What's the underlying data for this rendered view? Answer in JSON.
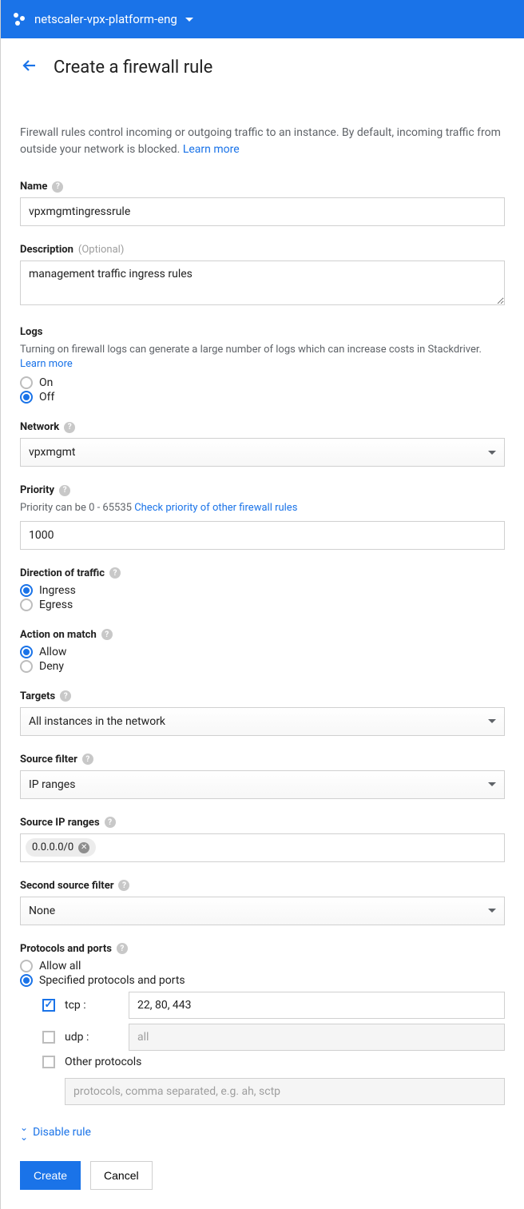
{
  "topbar": {
    "project": "netscaler-vpx-platform-eng"
  },
  "header": {
    "title": "Create a firewall rule"
  },
  "intro": {
    "text": "Firewall rules control incoming or outgoing traffic to an instance. By default, incoming traffic from outside your network is blocked. ",
    "learn_more": "Learn more"
  },
  "name": {
    "label": "Name",
    "value": "vpxmgmtingressrule"
  },
  "description": {
    "label": "Description",
    "optional": "(Optional)",
    "value": "management traffic ingress rules"
  },
  "logs": {
    "label": "Logs",
    "help": "Turning on firewall logs can generate a large number of logs which can increase costs in Stackdriver. ",
    "learn_more": "Learn more",
    "on_label": "On",
    "off_label": "Off",
    "selected": "off"
  },
  "network": {
    "label": "Network",
    "value": "vpxmgmt"
  },
  "priority": {
    "label": "Priority",
    "help_prefix": "Priority can be 0 - 65535 ",
    "link": "Check priority of other firewall rules",
    "value": "1000"
  },
  "direction": {
    "label": "Direction of traffic",
    "ingress_label": "Ingress",
    "egress_label": "Egress",
    "selected": "ingress"
  },
  "action": {
    "label": "Action on match",
    "allow_label": "Allow",
    "deny_label": "Deny",
    "selected": "allow"
  },
  "targets": {
    "label": "Targets",
    "value": "All instances in the network"
  },
  "source_filter": {
    "label": "Source filter",
    "value": "IP ranges"
  },
  "source_ip": {
    "label": "Source IP ranges",
    "chip": "0.0.0.0/0"
  },
  "second_filter": {
    "label": "Second source filter",
    "value": "None"
  },
  "protocols": {
    "label": "Protocols and ports",
    "allow_all_label": "Allow all",
    "specified_label": "Specified protocols and ports",
    "selected": "specified",
    "tcp_label": "tcp :",
    "tcp_checked": true,
    "tcp_value": "22, 80, 443",
    "udp_label": "udp :",
    "udp_checked": false,
    "udp_placeholder": "all",
    "other_label": "Other protocols",
    "other_checked": false,
    "other_placeholder": "protocols, comma separated, e.g. ah, sctp"
  },
  "disable_rule": "Disable rule",
  "buttons": {
    "create": "Create",
    "cancel": "Cancel"
  }
}
